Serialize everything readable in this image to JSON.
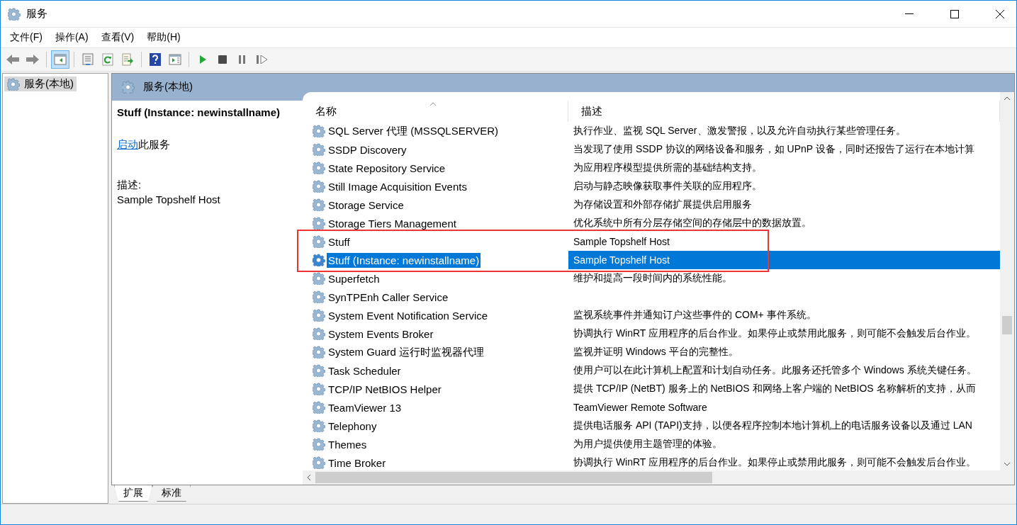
{
  "window": {
    "title": "服务"
  },
  "menu": [
    "文件(F)",
    "操作(A)",
    "查看(V)",
    "帮助(H)"
  ],
  "toolbar": [
    [
      {
        "kind": "back",
        "pressed": false
      },
      {
        "kind": "forward",
        "pressed": false
      }
    ],
    [
      {
        "kind": "tree",
        "pressed": true
      }
    ],
    [
      {
        "kind": "properties",
        "pressed": false
      },
      {
        "kind": "refresh",
        "pressed": false
      },
      {
        "kind": "export",
        "pressed": false
      }
    ],
    [
      {
        "kind": "help",
        "pressed": false
      },
      {
        "kind": "actionpane",
        "pressed": false
      }
    ],
    [
      {
        "kind": "start",
        "pressed": false
      },
      {
        "kind": "stop",
        "pressed": false
      },
      {
        "kind": "pause",
        "pressed": false
      },
      {
        "kind": "resume",
        "pressed": false
      }
    ]
  ],
  "tree": {
    "items": [
      {
        "label": "服务(本地)",
        "selected": true
      }
    ]
  },
  "panel": {
    "title": "服务(本地)"
  },
  "details": {
    "title": "Stuff (Instance: newinstallname)",
    "link": "启动",
    "link_suffix": "此服务",
    "description_label": "描述:",
    "description": "Sample Topshelf Host"
  },
  "table": {
    "columns": [
      {
        "label": "名称",
        "sorted": true
      },
      {
        "label": "描述",
        "sorted": false
      }
    ],
    "rows": [
      {
        "name": "SQL Server 代理 (MSSQLSERVER)",
        "description": "执行作业、监视 SQL Server、激发警报，以及允许自动执行某些管理任务。",
        "selected": false,
        "marked": false
      },
      {
        "name": "SSDP Discovery",
        "description": "当发现了使用 SSDP 协议的网络设备和服务，如 UPnP 设备，同时还报告了运行在本地计算",
        "selected": false,
        "marked": false
      },
      {
        "name": "State Repository Service",
        "description": "为应用程序模型提供所需的基础结构支持。",
        "selected": false,
        "marked": false
      },
      {
        "name": "Still Image Acquisition Events",
        "description": "启动与静态映像获取事件关联的应用程序。",
        "selected": false,
        "marked": false
      },
      {
        "name": "Storage Service",
        "description": "为存储设置和外部存储扩展提供启用服务",
        "selected": false,
        "marked": false
      },
      {
        "name": "Storage Tiers Management",
        "description": "优化系统中所有分层存储空间的存储层中的数据放置。",
        "selected": false,
        "marked": false
      },
      {
        "name": "Stuff",
        "description": "Sample Topshelf Host",
        "selected": false,
        "marked": true
      },
      {
        "name": "Stuff (Instance: newinstallname)",
        "description": "Sample Topshelf Host",
        "selected": true,
        "marked": true
      },
      {
        "name": "Superfetch",
        "description": "维护和提高一段时间内的系统性能。",
        "selected": false,
        "marked": false
      },
      {
        "name": "SynTPEnh Caller Service",
        "selected": false,
        "marked": false
      },
      {
        "name": "System Event Notification Service",
        "description": "监视系统事件并通知订户这些事件的 COM+ 事件系统。",
        "selected": false,
        "marked": false
      },
      {
        "name": "System Events Broker",
        "description": "协调执行 WinRT 应用程序的后台作业。如果停止或禁用此服务，则可能不会触发后台作业。",
        "selected": false,
        "marked": false
      },
      {
        "name": "System Guard 运行时监视器代理",
        "description": "监视并证明 Windows 平台的完整性。",
        "selected": false,
        "marked": false
      },
      {
        "name": "Task Scheduler",
        "description": "使用户可以在此计算机上配置和计划自动任务。此服务还托管多个 Windows 系统关键任务。",
        "selected": false,
        "marked": false
      },
      {
        "name": "TCP/IP NetBIOS Helper",
        "description": "提供 TCP/IP (NetBT) 服务上的 NetBIOS 和网络上客户端的 NetBIOS 名称解析的支持，从而",
        "selected": false,
        "marked": false
      },
      {
        "name": "TeamViewer 13",
        "description": "TeamViewer Remote Software",
        "selected": false,
        "marked": false
      },
      {
        "name": "Telephony",
        "description": "提供电话服务 API (TAPI)支持，以便各程序控制本地计算机上的电话服务设备以及通过 LAN",
        "selected": false,
        "marked": false
      },
      {
        "name": "Themes",
        "description": "为用户提供使用主题管理的体验。",
        "selected": false,
        "marked": false
      },
      {
        "name": "Time Broker",
        "description": "协调执行 WinRT 应用程序的后台作业。如果停止或禁用此服务，则可能不会触发后台作业。",
        "selected": false,
        "marked": false
      }
    ]
  },
  "bottom_tabs": [
    {
      "label": "扩展",
      "selected": true
    },
    {
      "label": "标准",
      "selected": false
    }
  ]
}
